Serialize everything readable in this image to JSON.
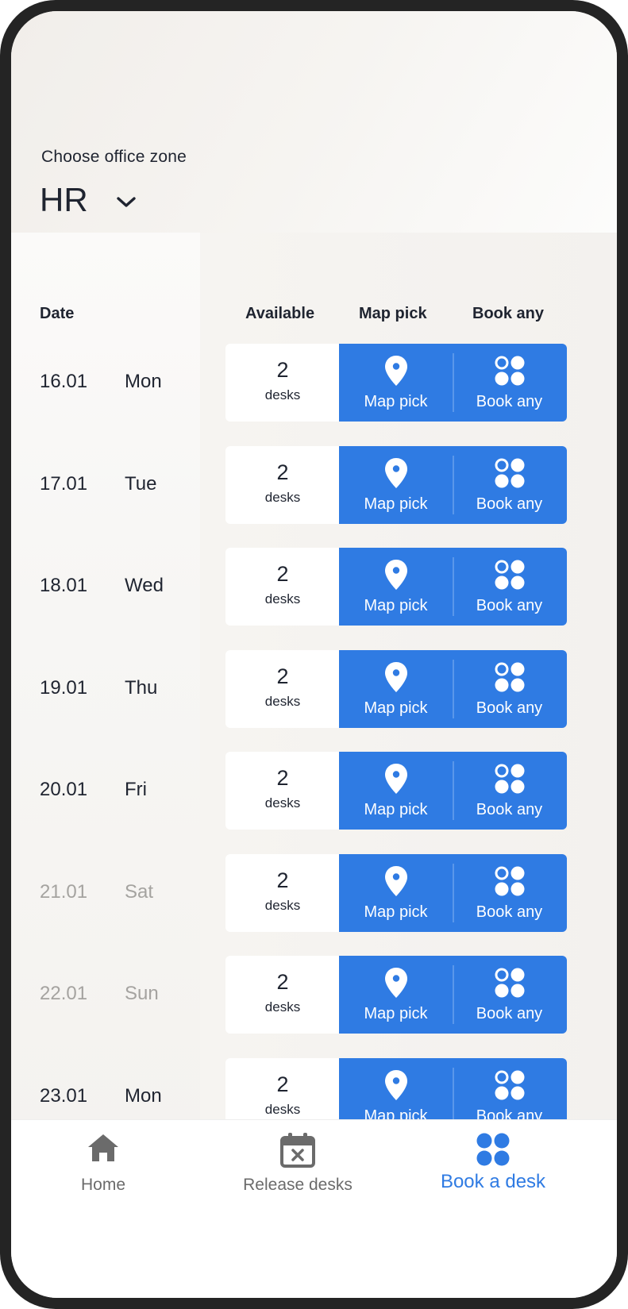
{
  "zone": {
    "label": "Choose office zone",
    "value": "HR"
  },
  "columns": {
    "date": "Date",
    "available": "Available",
    "map_pick": "Map pick",
    "book_any": "Book any"
  },
  "rows": [
    {
      "date": "16.01",
      "day": "Mon",
      "count": "2",
      "unit": "desks",
      "map_label": "Map pick",
      "any_label": "Book any",
      "weekend": false
    },
    {
      "date": "17.01",
      "day": "Tue",
      "count": "2",
      "unit": "desks",
      "map_label": "Map pick",
      "any_label": "Book any",
      "weekend": false
    },
    {
      "date": "18.01",
      "day": "Wed",
      "count": "2",
      "unit": "desks",
      "map_label": "Map pick",
      "any_label": "Book any",
      "weekend": false
    },
    {
      "date": "19.01",
      "day": "Thu",
      "count": "2",
      "unit": "desks",
      "map_label": "Map pick",
      "any_label": "Book any",
      "weekend": false
    },
    {
      "date": "20.01",
      "day": "Fri",
      "count": "2",
      "unit": "desks",
      "map_label": "Map pick",
      "any_label": "Book any",
      "weekend": false
    },
    {
      "date": "21.01",
      "day": "Sat",
      "count": "2",
      "unit": "desks",
      "map_label": "Map pick",
      "any_label": "Book any",
      "weekend": true
    },
    {
      "date": "22.01",
      "day": "Sun",
      "count": "2",
      "unit": "desks",
      "map_label": "Map pick",
      "any_label": "Book any",
      "weekend": true
    },
    {
      "date": "23.01",
      "day": "Mon",
      "count": "2",
      "unit": "desks",
      "map_label": "Map pick",
      "any_label": "Book any",
      "weekend": false
    }
  ],
  "tabs": {
    "home": {
      "label": "Home",
      "icon": "home-icon"
    },
    "release": {
      "label": "Release desks",
      "icon": "calendar-x-icon"
    },
    "book": {
      "label": "Book a desk",
      "icon": "grid-dots-icon",
      "active": true
    }
  },
  "colors": {
    "accent": "#2f7be3",
    "text": "#1f2430",
    "weekend_text": "#a5a3a0",
    "inactive_tab": "#6b6b6b"
  }
}
